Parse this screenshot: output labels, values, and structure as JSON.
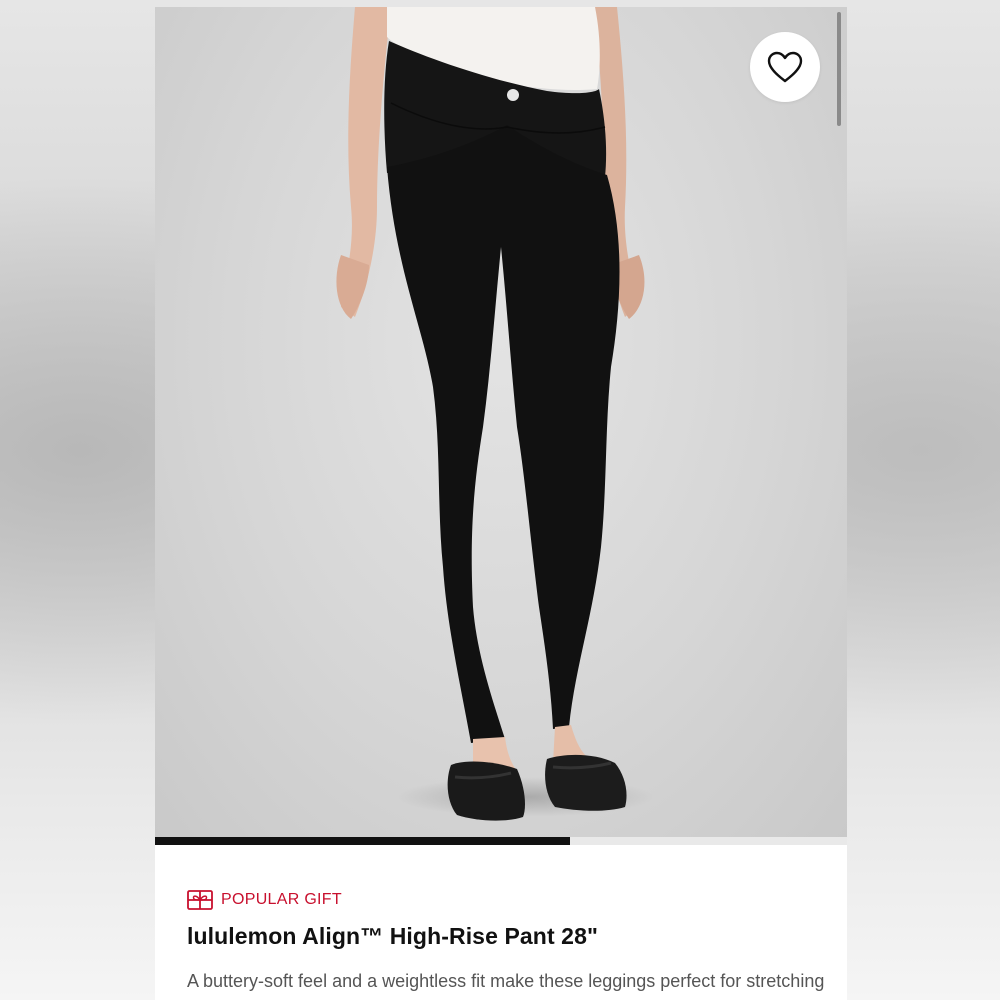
{
  "product": {
    "badge_label": "POPULAR GIFT",
    "title": "lululemon Align™ High-Rise Pant 28\"",
    "description": "A buttery-soft feel and a weightless fit make these leggings perfect for stretching out on the ice and relaxing"
  },
  "gallery": {
    "image_progress": 0.6
  },
  "icons": {
    "badge": "gift-icon",
    "favorite": "heart-icon",
    "logo": "lululemon-logo"
  },
  "colors": {
    "accent_red": "#c8102e",
    "progress": "#111111"
  }
}
